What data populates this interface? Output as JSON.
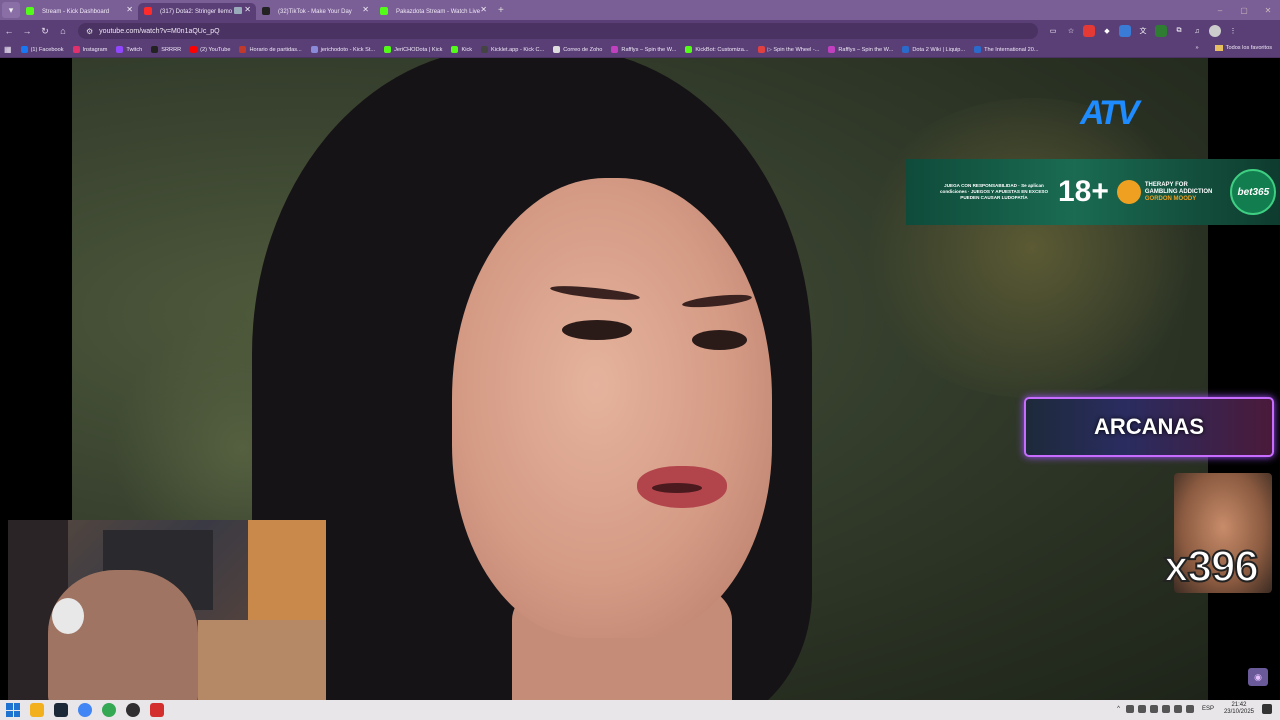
{
  "browser": {
    "tabs": [
      {
        "title": "Stream - Kick Dashboard",
        "favicon_color": "#53fc18",
        "active": false
      },
      {
        "title": "(317) Dota2: Stringer llemo",
        "favicon_color": "#ff2a2a",
        "active": true
      },
      {
        "title": "(32)TikTok - Make Your Day",
        "favicon_color": "#222222",
        "active": false
      },
      {
        "title": "Pakazdota Stream - Watch Live",
        "favicon_color": "#53fc18",
        "active": false
      }
    ],
    "new_tab_glyph": "+",
    "window_controls": [
      "–",
      "▢",
      "✕"
    ],
    "url": "youtube.com/watch?v=M0n1aQUc_pQ",
    "bookmarks": [
      {
        "label": "(1) Facebook",
        "color": "#1877f2"
      },
      {
        "label": "Instagram",
        "color": "#e1306c"
      },
      {
        "label": "Twitch",
        "color": "#9146ff"
      },
      {
        "label": "SRRRR",
        "color": "#222222"
      },
      {
        "label": "(2) YouTube",
        "color": "#ff0000"
      },
      {
        "label": "Horario de partidas...",
        "color": "#c0392b"
      },
      {
        "label": "jerichodoto - Kick St...",
        "color": "#8a8ad8"
      },
      {
        "label": "JeriCHODota | Kick",
        "color": "#53fc18"
      },
      {
        "label": "Kick",
        "color": "#53fc18"
      },
      {
        "label": "Kicklet.app - Kick C...",
        "color": "#444444"
      },
      {
        "label": "Correo de Zoho",
        "color": "#dddddd"
      },
      {
        "label": "Rafflys – Spin the W...",
        "color": "#c040c0"
      },
      {
        "label": "KickBot: Customiza...",
        "color": "#53fc18"
      },
      {
        "label": "▷ Spin the Wheel -...",
        "color": "#e04040"
      },
      {
        "label": "Rafflys – Spin the W...",
        "color": "#c040c0"
      },
      {
        "label": "Dota 2 Wiki | Liquip...",
        "color": "#2a6acb"
      },
      {
        "label": "The International 20...",
        "color": "#2a6acb"
      }
    ],
    "bookmarks_overflow": "»",
    "all_bookmarks": "Todos los favoritos"
  },
  "video": {
    "channel_logo": "ATV",
    "banner": {
      "left_text": "JUEGA CON RESPONSABILIDAD · Se aplican condiciones · JUEGOS Y APUESTAS EN EXCESO PUEDEN CAUSAR LUDOPATÍA",
      "age": "18+",
      "therapy_line1": "THERAPY FOR",
      "therapy_line2": "GAMBLING ADDICTION",
      "therapy_line3": "GORDON MOODY",
      "brand": "bet365"
    },
    "arcanas_label": "ARCANAS",
    "counter": "x396"
  },
  "taskbar": {
    "apps": [
      {
        "name": "folder",
        "color": "#f2b01e"
      },
      {
        "name": "steam",
        "color": "#1b2838"
      },
      {
        "name": "chrome",
        "color": "#4285f4"
      },
      {
        "name": "chrome-dev",
        "color": "#34a853"
      },
      {
        "name": "obs",
        "color": "#302e31"
      },
      {
        "name": "app",
        "color": "#d32f2f"
      }
    ],
    "language": "ESP",
    "time": "21:42",
    "date": "23/10/2025"
  }
}
